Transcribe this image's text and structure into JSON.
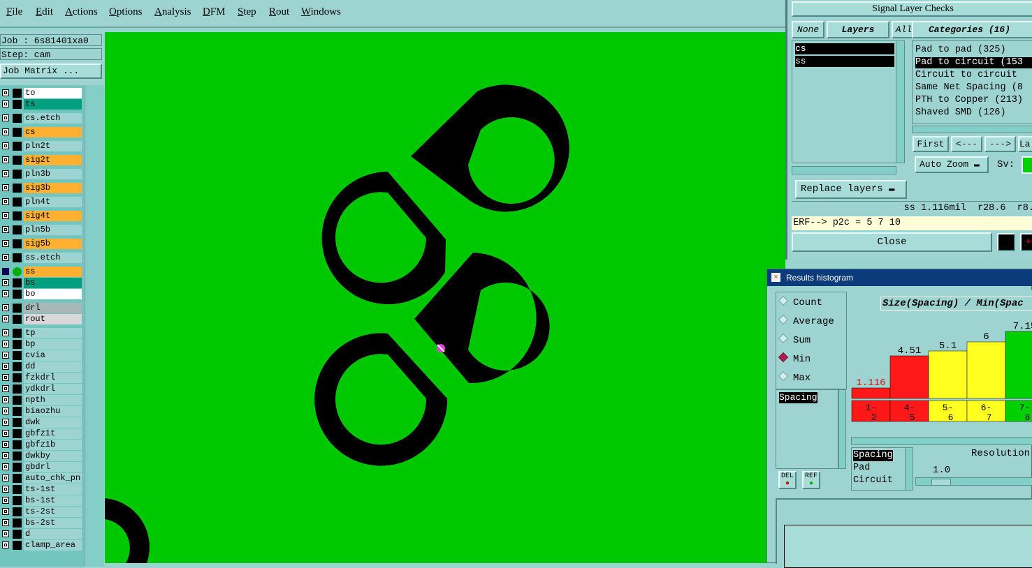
{
  "menubar": {
    "items": [
      "File",
      "Edit",
      "Actions",
      "Options",
      "Analysis",
      "DFM",
      "Step",
      "Rout",
      "Windows"
    ]
  },
  "job": {
    "job_label": "Job : 6s81401xa0",
    "step_label": "Step: cam",
    "matrix_button": "Job Matrix ..."
  },
  "layers": [
    {
      "name": "to",
      "color": "#ffffff",
      "dot": "#000000"
    },
    {
      "name": "ts",
      "color": "#00a080",
      "dot": "#000000"
    },
    {
      "name": "cs.etch",
      "color": "#9dd3d0",
      "dot": "#000000"
    },
    {
      "name": "cs",
      "color": "#ffb030",
      "dot": "#000000"
    },
    {
      "name": "pln2t",
      "color": "#9dd3d0",
      "dot": "#000000"
    },
    {
      "name": "sig2t",
      "color": "#ffb030",
      "dot": "#000000"
    },
    {
      "name": "pln3b",
      "color": "#9dd3d0",
      "dot": "#000000"
    },
    {
      "name": "sig3b",
      "color": "#ffb030",
      "dot": "#000000"
    },
    {
      "name": "pln4t",
      "color": "#9dd3d0",
      "dot": "#000000"
    },
    {
      "name": "sig4t",
      "color": "#ffb030",
      "dot": "#000000"
    },
    {
      "name": "pln5b",
      "color": "#9dd3d0",
      "dot": "#000000"
    },
    {
      "name": "sig5b",
      "color": "#ffb030",
      "dot": "#000000"
    },
    {
      "name": "ss.etch",
      "color": "#9dd3d0",
      "dot": "#000000"
    },
    {
      "name": "ss",
      "color": "#ffb030",
      "dot": "#00b000",
      "active": true
    },
    {
      "name": "bs",
      "color": "#00a080",
      "dot": "#000000"
    },
    {
      "name": "bo",
      "color": "#ffffff",
      "dot": "#000000"
    },
    {
      "name": "drl",
      "color": "#a8b8b8",
      "dot": "#000000"
    },
    {
      "name": "rout",
      "color": "#d8d8d8",
      "dot": "#000000"
    },
    {
      "name": "tp",
      "color": "#9dd3d0",
      "dot": "#000000"
    },
    {
      "name": "bp",
      "color": "#9dd3d0",
      "dot": "#000000"
    },
    {
      "name": "cvia",
      "color": "#9dd3d0",
      "dot": "#000000"
    },
    {
      "name": "dd",
      "color": "#9dd3d0",
      "dot": "#000000"
    },
    {
      "name": "fzkdrl",
      "color": "#9dd3d0",
      "dot": "#000000"
    },
    {
      "name": "ydkdrl",
      "color": "#9dd3d0",
      "dot": "#000000"
    },
    {
      "name": "npth",
      "color": "#9dd3d0",
      "dot": "#000000"
    },
    {
      "name": "biaozhu",
      "color": "#9dd3d0",
      "dot": "#000000"
    },
    {
      "name": "dwk",
      "color": "#9dd3d0",
      "dot": "#000000"
    },
    {
      "name": "gbfz1t",
      "color": "#9dd3d0",
      "dot": "#000000"
    },
    {
      "name": "gbfz1b",
      "color": "#9dd3d0",
      "dot": "#000000"
    },
    {
      "name": "dwkby",
      "color": "#9dd3d0",
      "dot": "#000000"
    },
    {
      "name": "gbdrl",
      "color": "#9dd3d0",
      "dot": "#000000"
    },
    {
      "name": "auto_chk_pn.",
      "color": "#9dd3d0",
      "dot": "#000000"
    },
    {
      "name": "ts-1st",
      "color": "#9dd3d0",
      "dot": "#000000"
    },
    {
      "name": "bs-1st",
      "color": "#9dd3d0",
      "dot": "#000000"
    },
    {
      "name": "ts-2st",
      "color": "#9dd3d0",
      "dot": "#000000"
    },
    {
      "name": "bs-2st",
      "color": "#9dd3d0",
      "dot": "#000000"
    },
    {
      "name": "d",
      "color": "#9dd3d0",
      "dot": "#000000"
    },
    {
      "name": "clamp_area",
      "color": "#9dd3d0",
      "dot": "#000000"
    }
  ],
  "signal_checks": {
    "title": "Signal Layer Checks",
    "none_btn": "None",
    "layers_tab": "Layers",
    "all_btn": "All",
    "categories_tab": "Categories (16)",
    "layer_items": [
      "cs",
      "ss"
    ],
    "category_items": [
      "Pad to pad (325)",
      "Pad to circuit (153",
      "Circuit to circuit",
      "Same Net Spacing (8",
      "PTH to Copper (213)",
      "Shaved SMD (126)"
    ],
    "first_btn": "First",
    "prev_btn": "<---",
    "next_btn": "--->",
    "last_btn": "La",
    "auto_zoom": "Auto Zoom",
    "sv_label": "Sv:",
    "replace_layers": "Replace layers",
    "status": "ss 1.116mil  r28.6  r8.",
    "erf": "ERF--> p2c = 5 7 10",
    "close_btn": "Close"
  },
  "histogram": {
    "title": "Results histogram",
    "modes": [
      "Count",
      "Average",
      "Sum",
      "Min",
      "Max"
    ],
    "selected_mode": "Min",
    "measure_list": [
      "Spacing"
    ],
    "del_btn": "DEL",
    "ref_btn": "REF",
    "chart_title": "Size(Spacing) / Min(Spac",
    "bottom_list": [
      "Spacing",
      "Pad",
      "Circuit"
    ],
    "resolution_label": "Resolution",
    "resolution_value": "1.0"
  },
  "chart_data": {
    "type": "bar",
    "categories": [
      "1-\n2",
      "4-\n5",
      "5-\n6",
      "6-\n7",
      "7-\n8"
    ],
    "values": [
      1.116,
      4.51,
      5.1,
      6,
      7.15
    ],
    "value_labels": [
      "1.116",
      "4.51",
      "5.1",
      "6",
      "7.15"
    ],
    "colors": [
      "#ff1818",
      "#ff1818",
      "#ffff20",
      "#ffff20",
      "#00d000"
    ],
    "title": "Size(Spacing) / Min(Spac"
  }
}
